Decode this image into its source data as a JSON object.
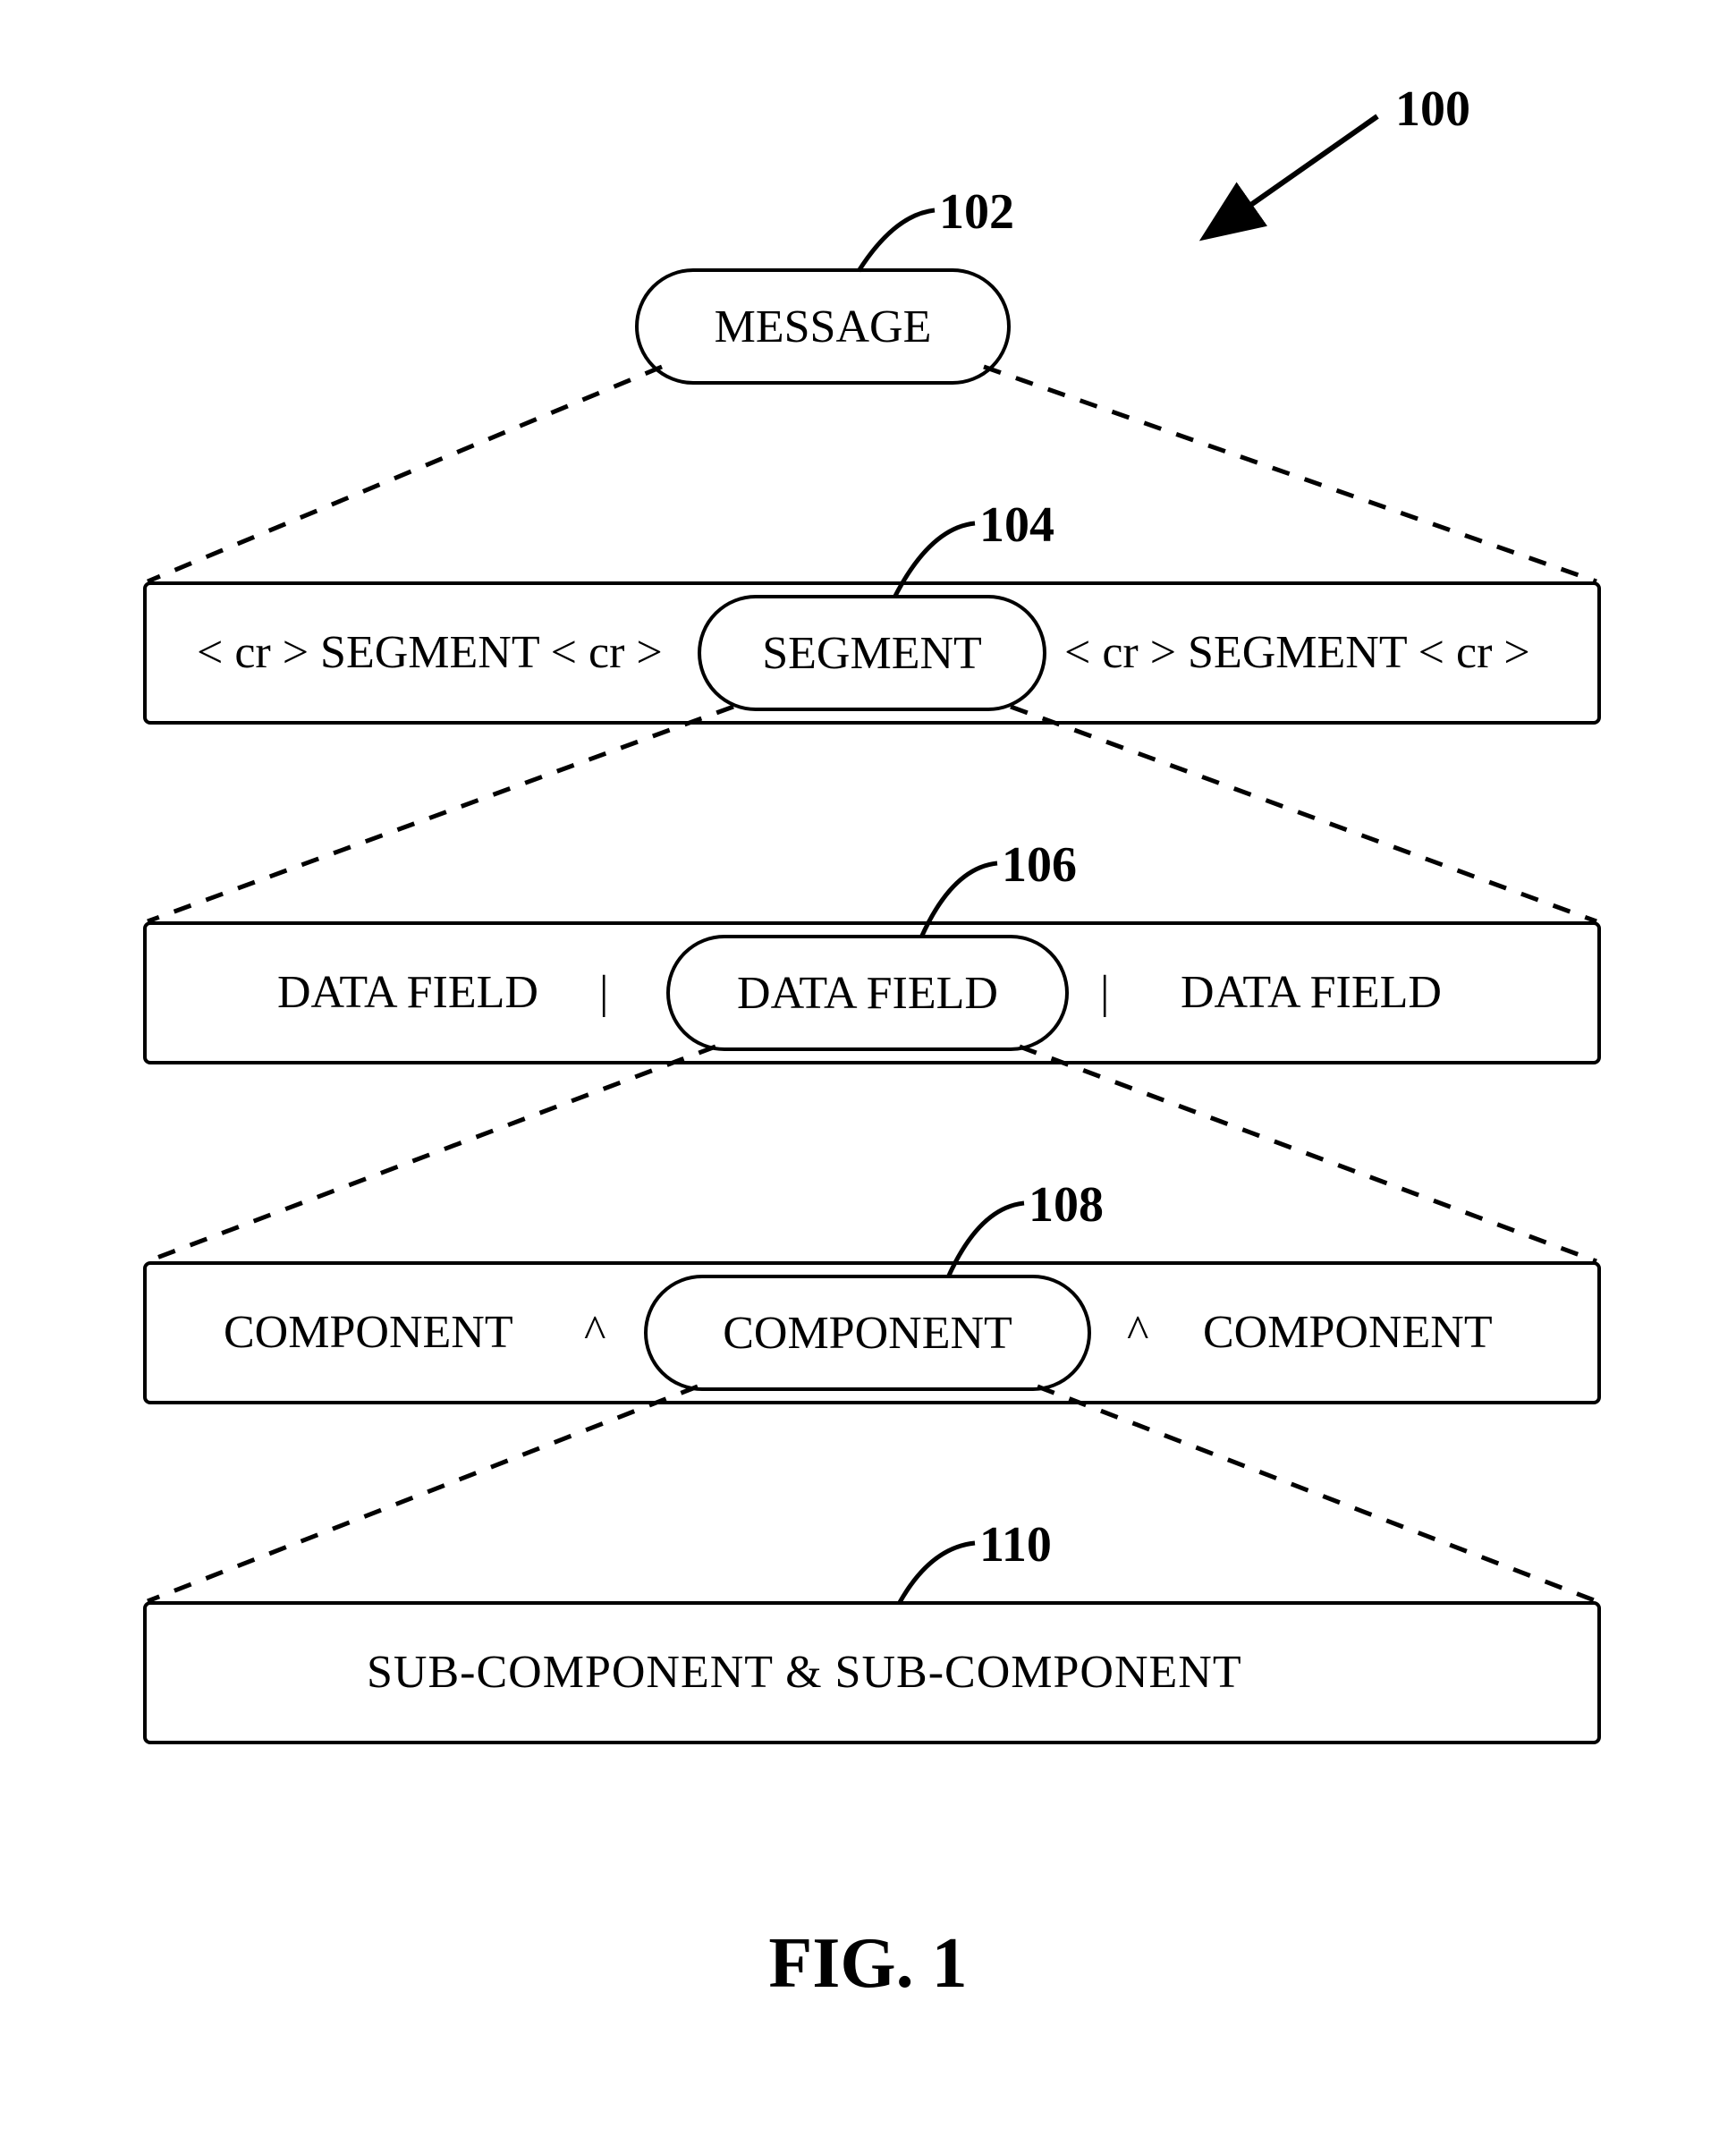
{
  "figure": {
    "caption": "FIG. 1",
    "ref_main": "100",
    "levels": {
      "message": {
        "label": "MESSAGE",
        "ref": "102"
      },
      "segment": {
        "ref": "104",
        "left": "< cr > SEGMENT < cr >",
        "pill": "SEGMENT",
        "right": "< cr > SEGMENT < cr >"
      },
      "datafield": {
        "ref": "106",
        "left": "DATA FIELD",
        "sep_left": "|",
        "pill": "DATA FIELD",
        "sep_right": "|",
        "right": "DATA FIELD"
      },
      "component": {
        "ref": "108",
        "left": "COMPONENT",
        "sep_left": "^",
        "pill": "COMPONENT",
        "sep_right": "^",
        "right": "COMPONENT"
      },
      "subcomponent": {
        "ref": "110",
        "text": "SUB-COMPONENT   &   SUB-COMPONENT"
      }
    }
  }
}
